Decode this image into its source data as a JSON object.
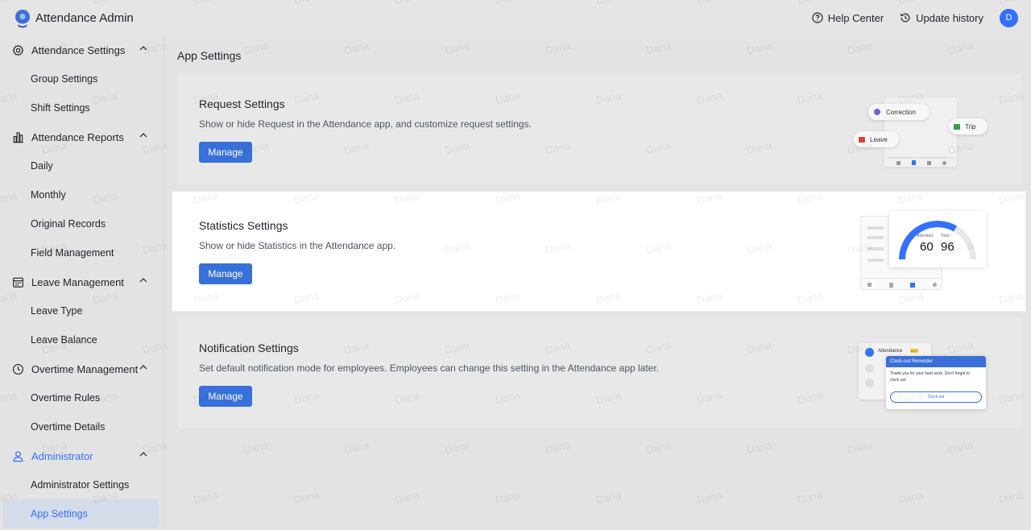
{
  "app": {
    "title": "Attendance Admin"
  },
  "header": {
    "help_label": "Help Center",
    "history_label": "Update history",
    "avatar_initial": "D"
  },
  "sidebar": {
    "groups": [
      {
        "label": "Attendance Settings",
        "icon": "gear-icon",
        "items": [
          "Group Settings",
          "Shift Settings"
        ]
      },
      {
        "label": "Attendance Reports",
        "icon": "bar-chart-icon",
        "items": [
          "Daily",
          "Monthly",
          "Original Records",
          "Field Management"
        ]
      },
      {
        "label": "Leave Management",
        "icon": "calendar-icon",
        "items": [
          "Leave Type",
          "Leave Balance"
        ]
      },
      {
        "label": "Overtime Management",
        "icon": "clock-icon",
        "items": [
          "Overtime Rules",
          "Overtime Details"
        ]
      },
      {
        "label": "Administrator",
        "icon": "user-icon",
        "items": [
          "Administrator Settings",
          "App Settings"
        ]
      }
    ],
    "active_item": "App Settings"
  },
  "main": {
    "title": "App Settings",
    "cards": [
      {
        "title": "Request Settings",
        "desc": "Show or hide Request in the Attendance app, and customize request settings.",
        "button": "Manage",
        "illus": {
          "correction": "Correction",
          "trip": "Trip",
          "leave": "Leave"
        }
      },
      {
        "title": "Statistics Settings",
        "desc": "Show or hide Statistics in the Attendance app.",
        "button": "Manage",
        "illus": {
          "attended_label": "Attended",
          "total_label": "Total",
          "attended": "60",
          "total": "96"
        }
      },
      {
        "title": "Notification Settings",
        "desc": "Set default notification mode for employees. Employees can change this setting in the Attendance app later.",
        "button": "Manage",
        "illus": {
          "app_name": "Attendance",
          "bot_badge": "BOT",
          "reminder_title": "Clock-out Reminder",
          "reminder_text": "Thank you for your hard work. Don't forget to clock out",
          "reminder_button": "Clock out"
        }
      }
    ]
  },
  "watermark": "Dana",
  "colors": {
    "accent": "#3370ff",
    "button": "#3870d9"
  }
}
